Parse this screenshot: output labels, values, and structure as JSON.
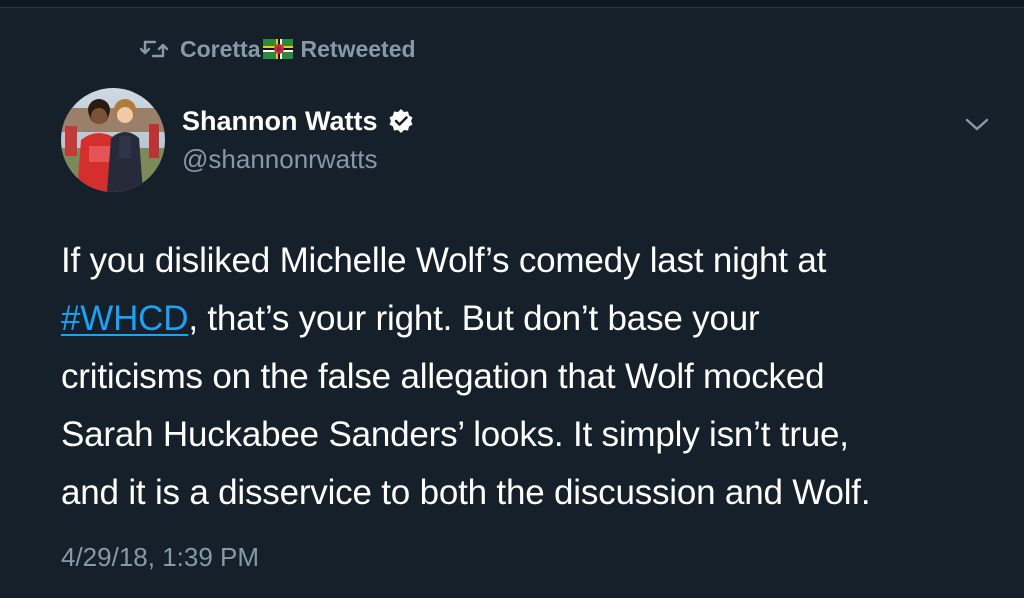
{
  "retweet": {
    "user": "Coretta",
    "label": "Retweeted"
  },
  "author": {
    "display_name": "Shannon Watts",
    "handle": "@shannonrwatts",
    "verified": true
  },
  "tweet": {
    "lines": [
      "If you disliked Michelle Wolf’s comedy last night at",
      ", that’s your right. But don’t base your",
      "criticisms on the false allegation that Wolf mocked",
      "Sarah Huckabee Sanders’ looks. It simply isn’t true,",
      "and it is a disservice to both the discussion and Wolf."
    ],
    "hashtag": "#WHCD"
  },
  "timestamp": "4/29/18, 1:39 PM",
  "icons": {
    "retweet": "retweet-icon",
    "flag": "dominica-flag-icon",
    "verified": "verified-badge-icon",
    "caret": "chevron-down-icon"
  },
  "colors": {
    "background": "#15202b",
    "secondary_text": "#8899a6",
    "link": "#1da1f2",
    "verified_badge": "#ffffff"
  }
}
